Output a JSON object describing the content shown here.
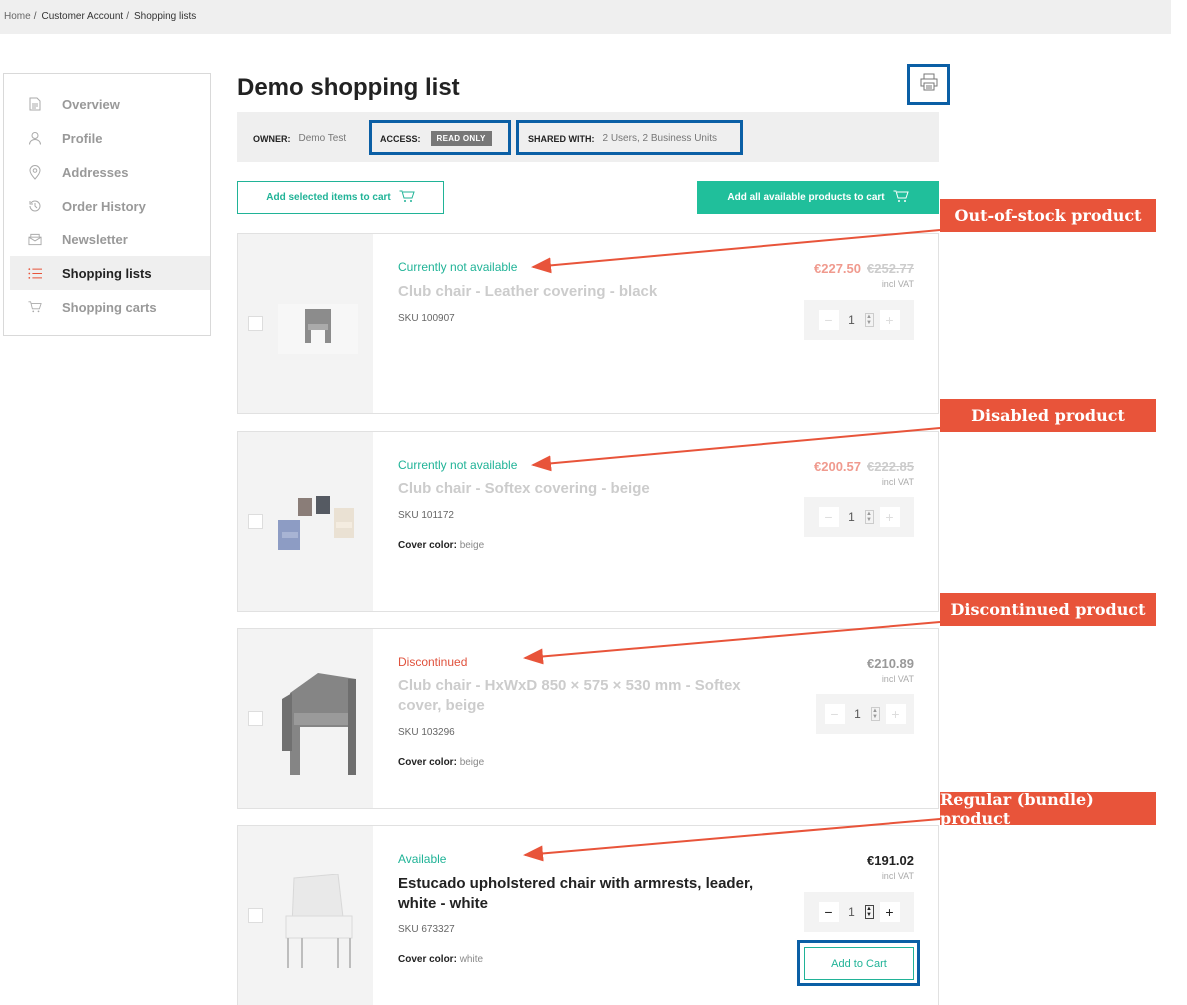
{
  "breadcrumb": {
    "home": "Home",
    "account": "Customer Account",
    "lists": "Shopping lists"
  },
  "sidebar": {
    "items": [
      {
        "label": "Overview",
        "icon": "document-icon"
      },
      {
        "label": "Profile",
        "icon": "user-icon"
      },
      {
        "label": "Addresses",
        "icon": "location-pin-icon"
      },
      {
        "label": "Order History",
        "icon": "history-icon"
      },
      {
        "label": "Newsletter",
        "icon": "envelope-icon"
      },
      {
        "label": "Shopping lists",
        "icon": "list-icon",
        "active": true
      },
      {
        "label": "Shopping carts",
        "icon": "cart-icon"
      }
    ]
  },
  "page": {
    "title": "Demo shopping list"
  },
  "meta": {
    "owner_label": "OWNER:",
    "owner_value": "Demo Test",
    "access_label": "ACCESS:",
    "access_value": "READ ONLY",
    "shared_label": "SHARED WITH:",
    "shared_value": "2 Users, 2 Business Units"
  },
  "actions": {
    "add_selected": "Add selected items to cart",
    "add_all": "Add all available products to cart"
  },
  "products": [
    {
      "status": "Currently not available",
      "name": "Club chair - Leather covering - black",
      "sku": "SKU 100907",
      "price": "€227.50",
      "old_price": "€252.77",
      "vat": "incl VAT",
      "qty": "1"
    },
    {
      "status": "Currently not available",
      "name": "Club chair - Softex covering - beige",
      "sku": "SKU 101172",
      "attr_label": "Cover color:",
      "attr_value": "beige",
      "price": "€200.57",
      "old_price": "€222.85",
      "vat": "incl VAT",
      "qty": "1"
    },
    {
      "status": "Discontinued",
      "name": "Club chair - HxWxD 850 × 575 × 530 mm - Softex cover, beige",
      "sku": "SKU 103296",
      "attr_label": "Cover color:",
      "attr_value": "beige",
      "price": "€210.89",
      "vat": "incl VAT",
      "qty": "1"
    },
    {
      "status": "Available",
      "name": "Estucado upholstered chair with armrests, leader, white - white",
      "sku": "SKU 673327",
      "attr_label": "Cover color:",
      "attr_value": "white",
      "price": "€191.02",
      "vat": "incl VAT",
      "qty": "1",
      "add_to_cart": "Add to Cart"
    }
  ],
  "annotations": [
    "Out-of-stock product",
    "Disabled product",
    "Discontinued product",
    "Regular (bundle) product"
  ],
  "colors": {
    "accent": "#20b397",
    "annotation": "#e8543a",
    "highlight": "#0b5fa5",
    "sale": "#f09a8e",
    "discontinued": "#e0523d"
  }
}
